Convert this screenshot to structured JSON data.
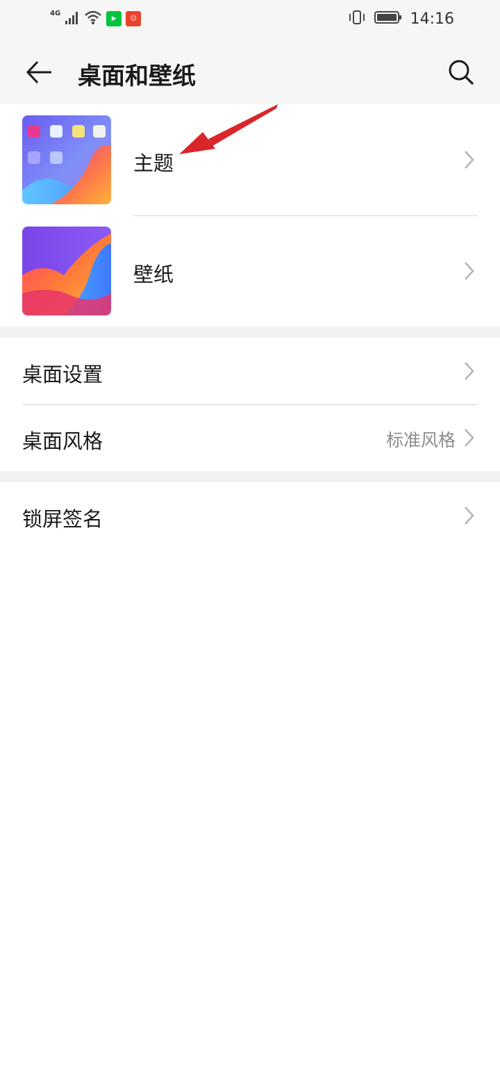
{
  "status_bar": {
    "network": "4G",
    "time": "14:16",
    "apps": [
      "iqiyi-app-icon",
      "reddit-like-app-icon"
    ]
  },
  "header": {
    "title": "桌面和壁纸"
  },
  "sections": {
    "appearance": {
      "theme_label": "主题",
      "wallpaper_label": "壁纸"
    },
    "home": {
      "settings_label": "桌面设置",
      "style_label": "桌面风格",
      "style_value": "标准风格"
    },
    "lock": {
      "signature_label": "锁屏签名"
    }
  },
  "colors": {
    "annotation_arrow": "#d9262a",
    "secondary_text": "#8c8c8c",
    "background_gray": "#f2f2f2"
  }
}
